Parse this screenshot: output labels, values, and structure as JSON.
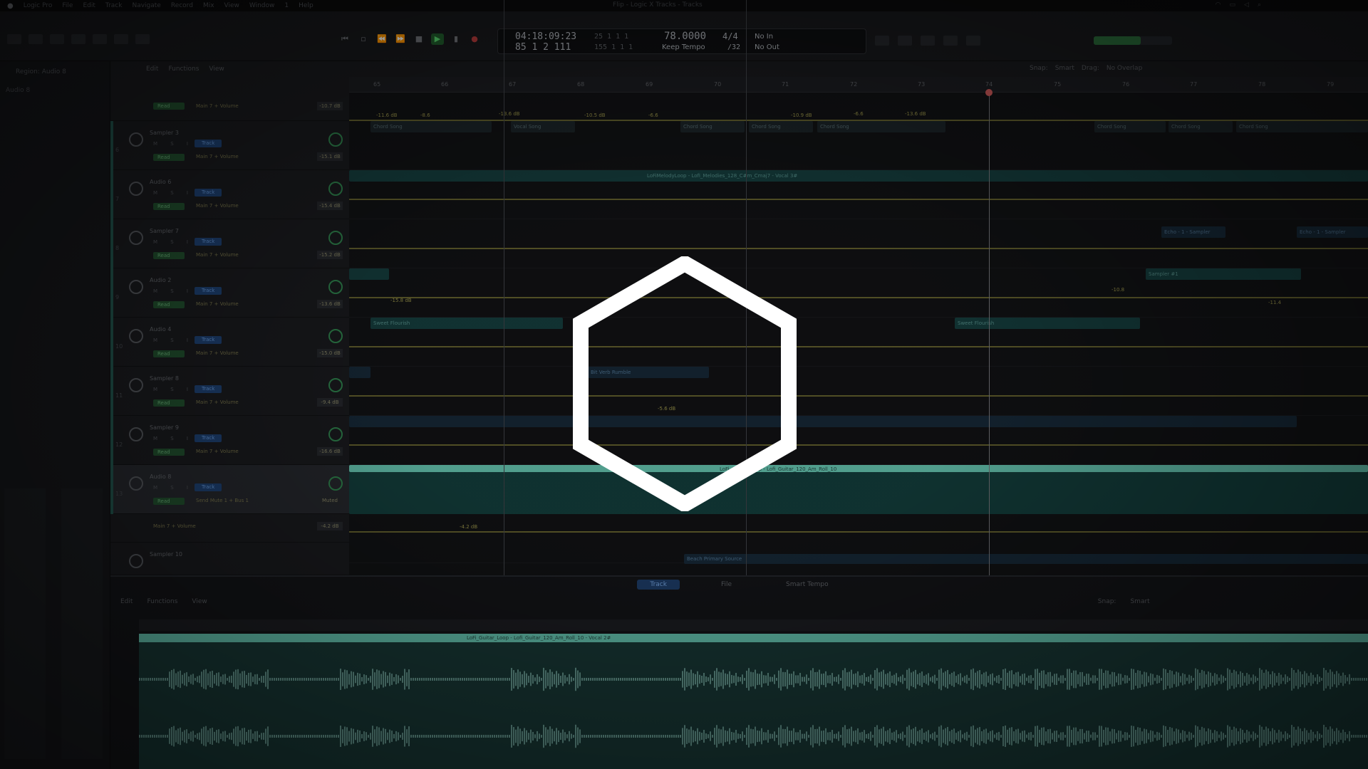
{
  "menubar": {
    "app": "Logic Pro",
    "items": [
      "File",
      "Edit",
      "Track",
      "Navigate",
      "Record",
      "Mix",
      "View",
      "Window",
      "1",
      "Help"
    ],
    "doc_title": "Flip - Logic X Tracks - Tracks"
  },
  "lcd": {
    "smpte": "04:18:09:23",
    "position": "85  1  2  111",
    "beats_top": "25  1  1      1",
    "beats_bottom": "155  1  1      1",
    "tempo": "78.0000",
    "tempo_label": "Keep Tempo",
    "signature": "4/4",
    "division": "/32",
    "in_label": "No In",
    "out_label": "No Out"
  },
  "track_toolbar": {
    "items": [
      "Edit",
      "Functions",
      "View"
    ],
    "snap_label": "Snap:",
    "snap_value": "Smart",
    "drag_label": "Drag:",
    "drag_value": "No Overlap"
  },
  "ruler": {
    "bars": [
      "65",
      "66",
      "67",
      "68",
      "69",
      "70",
      "71",
      "72",
      "73",
      "74",
      "75",
      "76",
      "77",
      "78",
      "79"
    ]
  },
  "inspector": {
    "title": "Region: Audio 8",
    "row1": "Audio 8"
  },
  "tracks": [
    {
      "num": "",
      "name": "",
      "param": "Main 7 + Volume",
      "value": "-10.7 dB",
      "read": "Read"
    },
    {
      "num": "6",
      "name": "Sampler 3",
      "param": "Main 7 + Volume",
      "value": "-15.1 dB",
      "read": "Read"
    },
    {
      "num": "7",
      "name": "Audio 6",
      "param": "Main 7 + Volume",
      "value": "-15.4 dB",
      "read": "Read"
    },
    {
      "num": "8",
      "name": "Sampler 7",
      "param": "Main 7 + Volume",
      "value": "-15.2 dB",
      "read": "Read"
    },
    {
      "num": "9",
      "name": "Audio 2",
      "param": "Main 7 + Volume",
      "value": "-13.6 dB",
      "read": "Read"
    },
    {
      "num": "10",
      "name": "Audio 4",
      "param": "Main 7 + Volume",
      "value": "-15.0 dB",
      "read": "Read"
    },
    {
      "num": "11",
      "name": "Sampler 8",
      "param": "Main 7 + Volume",
      "value": "-9.4 dB",
      "read": "Read"
    },
    {
      "num": "12",
      "name": "Sampler 9",
      "param": "Main 7 + Volume",
      "value": "-16.6 dB",
      "read": "Read"
    },
    {
      "num": "13",
      "name": "Audio 8",
      "param": "Send Mute 1 + Bus 1",
      "value": "Muted",
      "read": "Read"
    },
    {
      "num": "",
      "name": "",
      "param": "Main 7 + Volume",
      "value": "-4.2 dB",
      "read": ""
    },
    {
      "num": "14",
      "name": "Sampler 10",
      "param": "",
      "value": "",
      "read": ""
    }
  ],
  "track_chip": "Track",
  "track_buttons": "M  S  I",
  "regions": {
    "lane1": [
      "Chord Song",
      "Vocal Song",
      "Chord Song",
      "Chord Song",
      "Chord Song",
      "Chord Song",
      "Chord Song",
      "Chord Song"
    ],
    "lane2": [
      "LoFiMelodyLoop - Lofi_Melodies_128_C#m_Cmaj7 - Vocal 3#",
      "LoFiMelodyLoop - Lofi_Melodies_128"
    ],
    "lane4a": "Echo - 1 - Sampler",
    "lane4b": "Echo - 1 - Sampler",
    "lane5": "Sampler #1",
    "lane6a": "Sweet Flourish",
    "lane6b": "Sweet Flourish",
    "lane7": "Bit Verb Rumble",
    "lane9": "LoFi_Guitar_Loop - Lofi_Guitar_120_Am_Roll_10",
    "lane11": "Beach Primary Source"
  },
  "automation_labels": [
    "-11.6 dB",
    "-8.6",
    "-13.6 dB",
    "-10.5 dB",
    "-6.6",
    "-10.9 dB",
    "-6.6",
    "-13.6 dB",
    "-15.8 dB",
    "-10.8",
    "-11.4",
    "-5.6 dB",
    "-4.2 dB"
  ],
  "editor": {
    "tabs": [
      "Track",
      "File",
      "Smart Tempo"
    ],
    "toolbar": [
      "Edit",
      "Functions",
      "View"
    ],
    "snap_label": "Snap:",
    "snap_value": "Smart",
    "region_label": "LoFi_Guitar_Loop - Lofi_Guitar_120_Am_Roll_10 - Vocal 2#",
    "region_label_2": "LoFi_Guitar_Loop - Lofi_Guitar_120_Am_Roll_10"
  },
  "overlay": {
    "icon": "hexagon-icon",
    "stroke_color": "#ffffff"
  }
}
